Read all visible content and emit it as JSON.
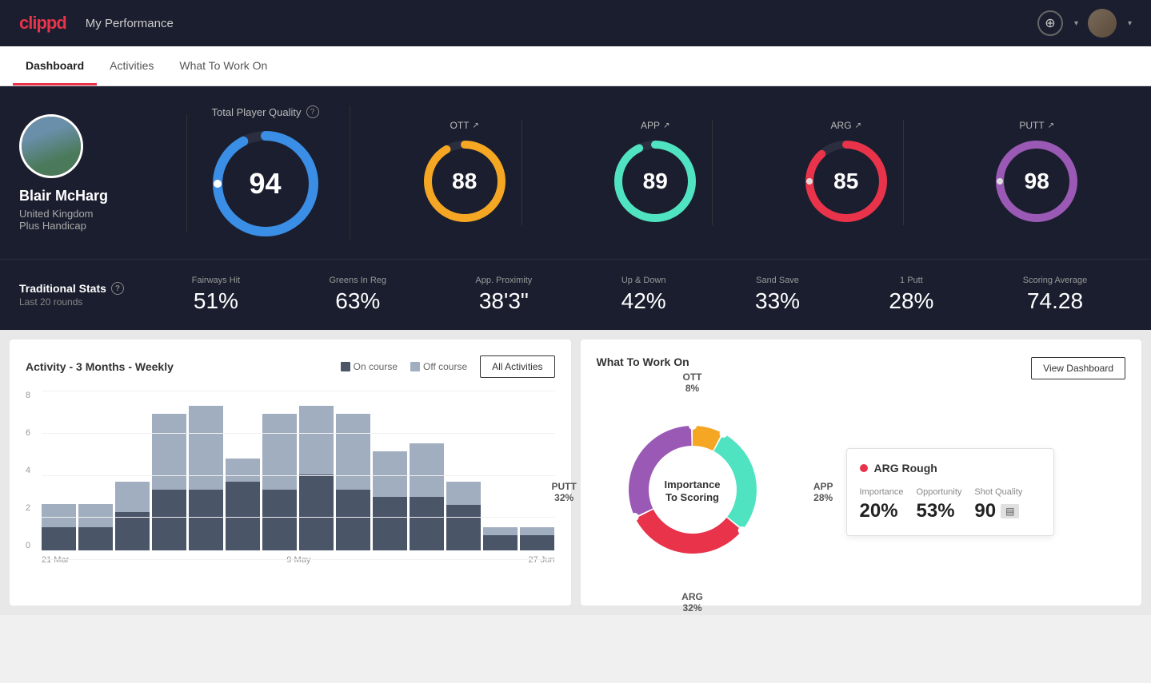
{
  "header": {
    "logo": "clippd",
    "title": "My Performance",
    "add_label": "+",
    "dropdown_label": "▾"
  },
  "tabs": [
    {
      "id": "dashboard",
      "label": "Dashboard",
      "active": true
    },
    {
      "id": "activities",
      "label": "Activities",
      "active": false
    },
    {
      "id": "what-to-work-on",
      "label": "What To Work On",
      "active": false
    }
  ],
  "player": {
    "name": "Blair McHarg",
    "country": "United Kingdom",
    "handicap": "Plus Handicap"
  },
  "total_quality": {
    "label": "Total Player Quality",
    "score": "94",
    "color": "#3a8ee6"
  },
  "sub_scores": [
    {
      "id": "ott",
      "label": "OTT",
      "value": "88",
      "color": "#f5a623"
    },
    {
      "id": "app",
      "label": "APP",
      "value": "89",
      "color": "#50e3c2"
    },
    {
      "id": "arg",
      "label": "ARG",
      "value": "85",
      "color": "#e8334a"
    },
    {
      "id": "putt",
      "label": "PUTT",
      "value": "98",
      "color": "#9b59b6"
    }
  ],
  "traditional_stats": {
    "title": "Traditional Stats",
    "sub": "Last 20 rounds",
    "stats": [
      {
        "label": "Fairways Hit",
        "value": "51%"
      },
      {
        "label": "Greens In Reg",
        "value": "63%"
      },
      {
        "label": "App. Proximity",
        "value": "38'3\""
      },
      {
        "label": "Up & Down",
        "value": "42%"
      },
      {
        "label": "Sand Save",
        "value": "33%"
      },
      {
        "label": "1 Putt",
        "value": "28%"
      },
      {
        "label": "Scoring Average",
        "value": "74.28"
      }
    ]
  },
  "activity_chart": {
    "title": "Activity - 3 Months - Weekly",
    "legend": [
      {
        "label": "On course",
        "color": "#4a5568"
      },
      {
        "label": "Off course",
        "color": "#a0aec0"
      }
    ],
    "all_activities_btn": "All Activities",
    "y_labels": [
      "8",
      "6",
      "4",
      "2",
      "0"
    ],
    "x_labels": [
      "21 Mar",
      "9 May",
      "27 Jun"
    ],
    "bars": [
      {
        "dark": 15,
        "light": 15
      },
      {
        "dark": 15,
        "light": 15
      },
      {
        "dark": 25,
        "light": 20
      },
      {
        "dark": 40,
        "light": 50
      },
      {
        "dark": 40,
        "light": 55
      },
      {
        "dark": 45,
        "light": 15
      },
      {
        "dark": 40,
        "light": 50
      },
      {
        "dark": 50,
        "light": 45
      },
      {
        "dark": 40,
        "light": 50
      },
      {
        "dark": 35,
        "light": 30
      },
      {
        "dark": 35,
        "light": 35
      },
      {
        "dark": 30,
        "light": 15
      },
      {
        "dark": 10,
        "light": 5
      },
      {
        "dark": 10,
        "light": 5
      }
    ]
  },
  "what_to_work_on": {
    "title": "What To Work On",
    "view_dashboard_btn": "View Dashboard",
    "donut_center": "Importance\nTo Scoring",
    "segments": [
      {
        "label": "OTT\n8%",
        "color": "#f5a623",
        "percent": 8
      },
      {
        "label": "APP\n28%",
        "color": "#50e3c2",
        "percent": 28
      },
      {
        "label": "ARG\n32%",
        "color": "#e8334a",
        "percent": 32
      },
      {
        "label": "PUTT\n32%",
        "color": "#9b59b6",
        "percent": 32
      }
    ],
    "detail_card": {
      "title": "ARG Rough",
      "metrics": [
        {
          "label": "Importance",
          "value": "20%"
        },
        {
          "label": "Opportunity",
          "value": "53%"
        },
        {
          "label": "Shot Quality",
          "value": "90",
          "badge": true
        }
      ]
    }
  }
}
